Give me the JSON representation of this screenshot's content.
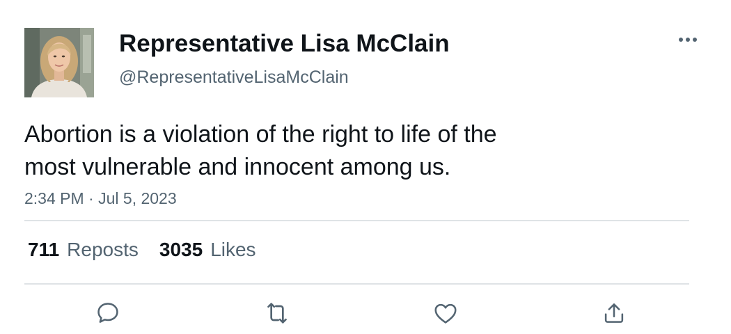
{
  "author": {
    "display_name": "Representative Lisa McClain",
    "handle": "@RepresentativeLisaMcClain",
    "avatar_icon": "profile-photo"
  },
  "tweet": {
    "text_line1": "Abortion is a violation of the right to life of the",
    "text_line2": "most vulnerable and innocent among us.",
    "time": "2:34 PM",
    "separator": " · ",
    "date": "Jul 5, 2023"
  },
  "stats": {
    "reposts_count": "711",
    "reposts_label": "Reposts",
    "likes_count": "3035",
    "likes_label": "Likes"
  },
  "actions": {
    "reply_icon": "speech-bubble-icon",
    "repost_icon": "repost-arrows-icon",
    "like_icon": "heart-icon",
    "share_icon": "share-upload-icon",
    "more_icon": "ellipsis-icon"
  },
  "colors": {
    "text_primary": "#0f1419",
    "text_secondary": "#536471",
    "divider": "#dfe3e6",
    "icon": "#536471"
  }
}
